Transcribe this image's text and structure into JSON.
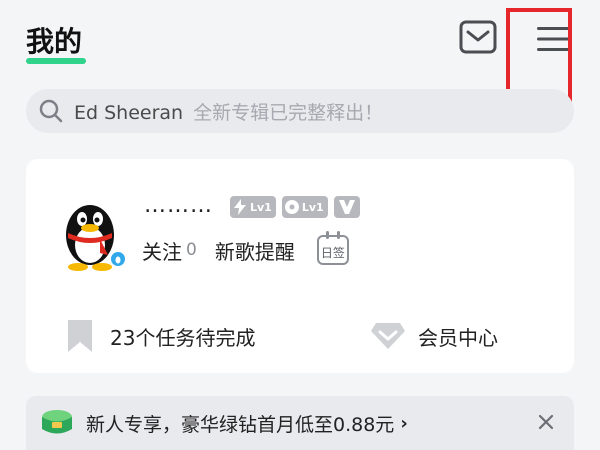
{
  "header": {
    "title": "我的",
    "mail_icon": "mail-icon",
    "menu_icon": "hamburger-menu-icon",
    "accent_color": "#2fd38b",
    "highlight_color": "#e5262a"
  },
  "search": {
    "value": "Ed Sheeran",
    "hint": "全新专辑已完整释出！",
    "icon": "search-icon"
  },
  "profile": {
    "avatar_icon": "qq-penguin-avatar",
    "nickname": "………",
    "badges": [
      {
        "icon": "lightning-icon",
        "label": "Lv1"
      },
      {
        "icon": "disc-icon",
        "label": "Lv1"
      },
      {
        "icon": "v-badge-icon",
        "label": ""
      }
    ],
    "follow_label": "关注",
    "follow_count": "0",
    "new_song_reminder": "新歌提醒",
    "sign_in_label": "日签",
    "tasks_label": "23个任务待完成",
    "vip_center_label": "会员中心"
  },
  "promo": {
    "icon": "green-diamond-icon",
    "text": "新人专享，豪华绿钻首月低至0.88元",
    "chevron": "›",
    "close_icon": "close-icon"
  }
}
